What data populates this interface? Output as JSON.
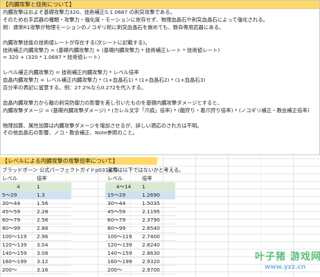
{
  "section1": {
    "header": "【内臓攻撃と技術について】",
    "lines": [
      "内臓攻撃はおよそ基礎攻撃力320、技術補正S:1.0687 の刺突攻撃である。",
      "そのため右手武器の種類・攻撃力・強化度・モーションに依存せず、物理血晶石や刺突血晶石によって強化される。",
      "例：通常R1攻撃が物理モーションのノコギリ鉈に刺突血晶石を嵌めても、致命専用武器にある。",
      "",
      "内臓攻撃技能の技術値レートが存在する(次シートに記載する)。",
      "技術補正内臓攻撃力 = (基礎内臓攻撃力 + (基礎内臓攻撃力 * 技術補正レート * 技術値レート)",
      "                  = 320 + (320 * 1.0687 * 技術値レート)",
      "",
      "レベル補正内臓攻撃力 = 技術補正内臓攻撃力 * レベル倍率",
      "血晶内臓攻撃力 = レベル補正内臓攻撃力 * (1+血晶石1) * (1+血晶石2) * (1+血晶石3)",
      "    百分率の表記に留意する。例：27.2%なら0.272を代入する。",
      "",
      "血晶内臓攻撃力から敵の刺突防御力の影響を差し引いたものを基礎内臓攻撃ダメージとすると、",
      "内臓攻撃ダメージ = (基礎内臓攻撃ダメージ) * (カレル文字「爪痕」倍率) * (餓狩り・着爪狩り倍率) * (ノコギリ補正・教会補正倍率)",
      "",
      "物理加算、属性加算は内臓攻撃ダメージを増加させるが、詳しい適応のされ方は不明。",
      "その他血晶石の影響、ノコ・教会補正、Note参照のこと。"
    ]
  },
  "section2": {
    "header": "【レベルによる内臓攻撃の攻撃倍率について】",
    "note_left": "ブラッドボーン 公式パーフェクトガイドp031より",
    "note_right": "実際は以下ではないかと考える。",
    "table_left": {
      "head": [
        "レベル",
        "倍率"
      ],
      "rows": [
        [
          "4",
          "1"
        ],
        [
          "5～29",
          "1.3"
        ],
        [
          "30～44",
          "1.56"
        ],
        [
          "45～59",
          "2.28"
        ],
        [
          "60～79",
          "2.56"
        ],
        [
          "80～99",
          "2.88"
        ],
        [
          "100～119",
          "2.96"
        ],
        [
          "120～139",
          "3.04"
        ],
        [
          "140～159",
          "3.08"
        ],
        [
          "160～199",
          "3.12"
        ],
        [
          "200～",
          "3.16"
        ]
      ]
    },
    "table_right": {
      "head": [
        "レベル",
        "倍率"
      ],
      "rows": [
        [
          "4～14",
          "1"
        ],
        [
          "15～29",
          "1.2690"
        ],
        [
          "30～44",
          "1.5035"
        ],
        [
          "45～59",
          "2.1195"
        ],
        [
          "60～79",
          "2.3790"
        ],
        [
          "80～99",
          "2.6540"
        ],
        [
          "100～119",
          "2.7400"
        ],
        [
          "120～139",
          "2.8240"
        ],
        [
          "140～159",
          "2.8630"
        ],
        [
          "160～199",
          "2.9320"
        ],
        [
          "200～",
          "2.9700"
        ]
      ]
    }
  },
  "watermark": {
    "logo": "叶子猪 游戏网",
    "url": "www.yzz.cn"
  }
}
